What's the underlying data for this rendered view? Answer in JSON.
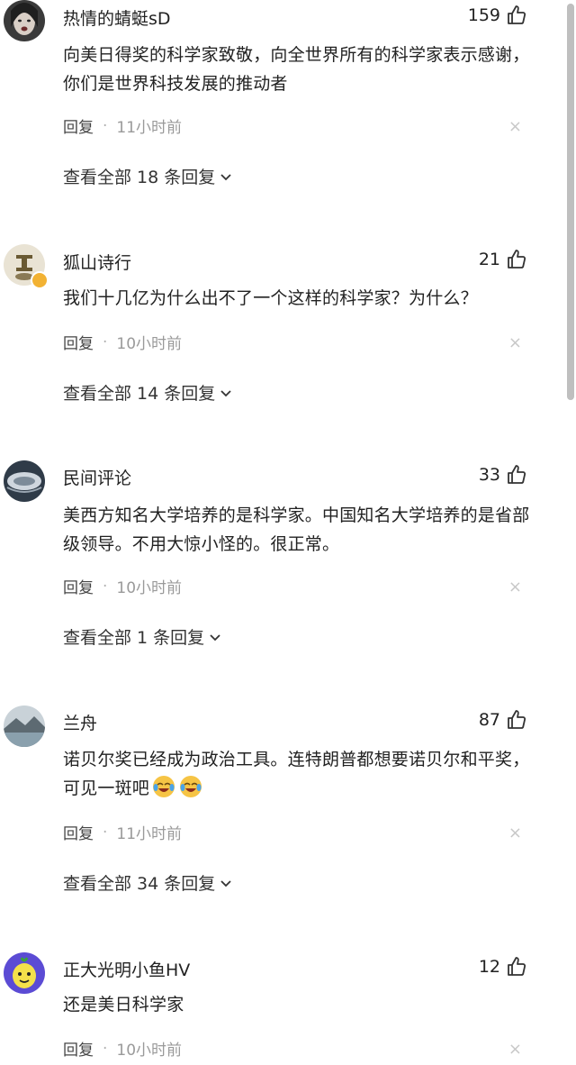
{
  "comments": [
    {
      "username": "热情的蜻蜓sD",
      "likes": "159",
      "text": "向美日得奖的科学家致敬，向全世界所有的科学家表示感谢，你们是世界科技发展的推动者",
      "reply_label": "回复",
      "separator": "·",
      "time": "11小时前",
      "close_glyph": "×",
      "view_all": "查看全部 18 条回复"
    },
    {
      "username": "狐山诗行",
      "likes": "21",
      "text": "我们十几亿为什么出不了一个这样的科学家？为什么？",
      "reply_label": "回复",
      "separator": "·",
      "time": "10小时前",
      "close_glyph": "×",
      "view_all": "查看全部 14 条回复"
    },
    {
      "username": "民间评论",
      "likes": "33",
      "text": "美西方知名大学培养的是科学家。中国知名大学培养的是省部级领导。不用大惊小怪的。很正常。",
      "reply_label": "回复",
      "separator": "·",
      "time": "10小时前",
      "close_glyph": "×",
      "view_all": "查看全部 1 条回复"
    },
    {
      "username": "兰舟",
      "likes": "87",
      "text": "诺贝尔奖已经成为政治工具。连特朗普都想要诺贝尔和平奖，可见一斑吧",
      "emoji_count": 2,
      "emoji_name": "laugh-cry-emoji",
      "reply_label": "回复",
      "separator": "·",
      "time": "11小时前",
      "close_glyph": "×",
      "view_all": "查看全部 34 条回复"
    },
    {
      "username": "正大光明小鱼HV",
      "likes": "12",
      "text": "还是美日科学家",
      "reply_label": "回复",
      "separator": "·",
      "time": "10小时前",
      "close_glyph": "×"
    }
  ],
  "icons": {
    "like": "thumbs-up-icon",
    "expand": "chevron-down-icon",
    "close": "close-icon"
  },
  "colors": {
    "text": "#222222",
    "meta": "#9a9a9a",
    "close": "#c8c8c8",
    "badge": "#f2b233"
  }
}
